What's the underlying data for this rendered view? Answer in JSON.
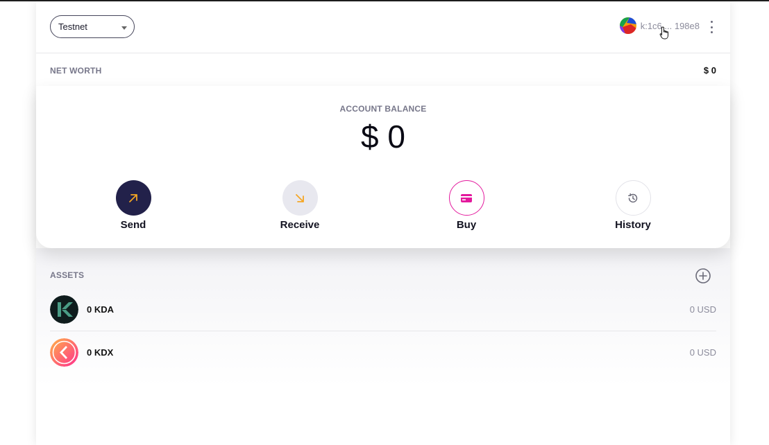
{
  "header": {
    "network": "Testnet",
    "account_address": "k:1c6 ... 198e8"
  },
  "net_worth": {
    "label": "NET WORTH",
    "value": "$ 0"
  },
  "balance": {
    "label": "ACCOUNT BALANCE",
    "value": "$ 0"
  },
  "actions": [
    {
      "label": "Send",
      "icon": "arrow-up-right-icon"
    },
    {
      "label": "Receive",
      "icon": "arrow-down-right-icon"
    },
    {
      "label": "Buy",
      "icon": "credit-card-icon"
    },
    {
      "label": "History",
      "icon": "history-icon"
    }
  ],
  "assets": {
    "label": "ASSETS",
    "items": [
      {
        "name": "0 KDA",
        "usd": "0 USD",
        "icon": "kadena-logo"
      },
      {
        "name": "0 KDX",
        "usd": "0 USD",
        "icon": "kaddex-logo"
      }
    ]
  },
  "colors": {
    "send_bg": "#22214a",
    "accent_orange": "#f5a623",
    "buy_pink": "#e3199d"
  }
}
